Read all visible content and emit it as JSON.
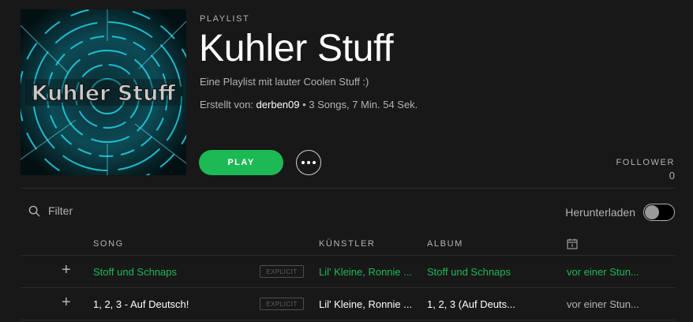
{
  "playlist": {
    "type_label": "PLAYLIST",
    "title": "Kuhler Stuff",
    "description": "Eine Playlist mit lauter Coolen Stuff :)",
    "created_by_label": "Erstellt von:",
    "owner": "derben09",
    "summary": " • 3 Songs, 7 Min. 54 Sek.",
    "cover_text": "Kuhler Stuff"
  },
  "actions": {
    "play_label": "PLAY",
    "more_icon": "more-dots-icon"
  },
  "followers": {
    "label": "FOLLOWER",
    "count": "0"
  },
  "toolbar": {
    "filter_placeholder": "Filter",
    "download_label": "Herunterladen",
    "download_enabled": false
  },
  "table": {
    "headers": {
      "song": "SONG",
      "artist": "KÜNSTLER",
      "album": "ALBUM",
      "date_icon": "calendar-icon"
    },
    "rows": [
      {
        "add_symbol": "+",
        "title": "Stoff und Schnaps",
        "explicit": "EXPLICIT",
        "artist": "Lil' Kleine, Ronnie ...",
        "album": "Stoff und Schnaps",
        "added": "vor einer Stun...",
        "playing": true
      },
      {
        "add_symbol": "+",
        "title": "1, 2, 3 - Auf Deutsch!",
        "explicit": "EXPLICIT",
        "artist": "Lil' Kleine, Ronnie ...",
        "album": "1, 2, 3 (Auf Deuts...",
        "added": "vor einer Stun...",
        "playing": false
      }
    ]
  },
  "colors": {
    "background": "#181818",
    "accent": "#1db954",
    "text_muted": "#b3b3b3"
  }
}
